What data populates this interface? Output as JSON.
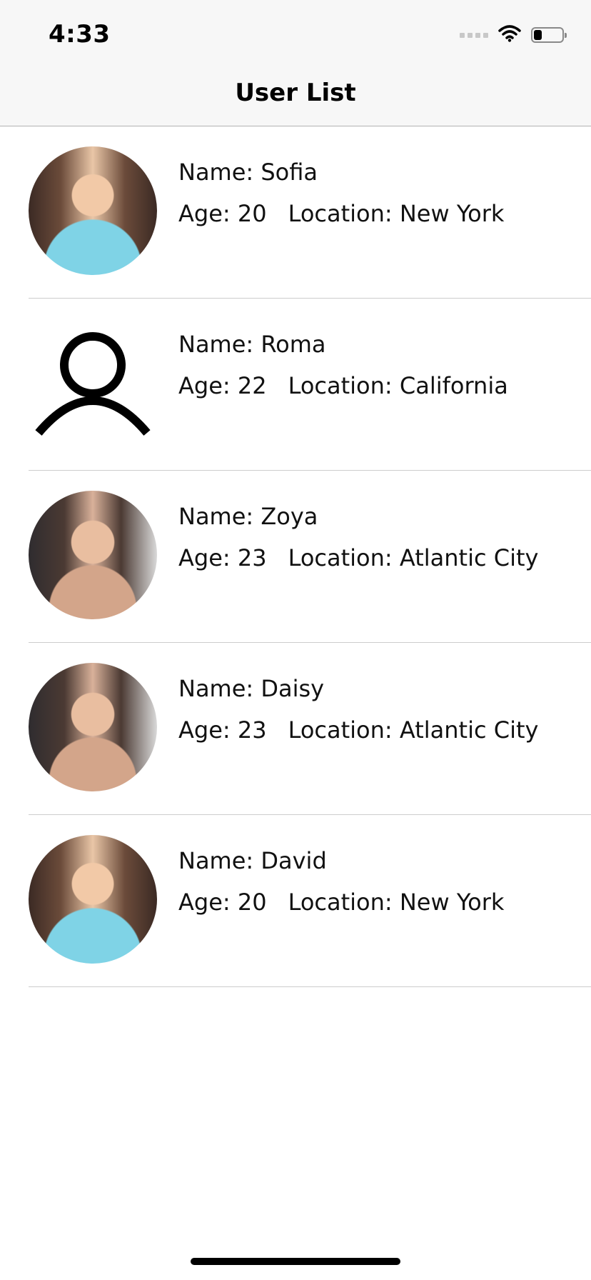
{
  "status_bar": {
    "time": "4:33",
    "icons": [
      "signal-dots-icon",
      "wifi-icon",
      "battery-icon"
    ],
    "battery_level": 0.3
  },
  "nav": {
    "title": "User List"
  },
  "users": [
    {
      "name_label": "Name: Sofia",
      "age_label": "Age: 20",
      "location_label": "Location: New York",
      "avatar": "photo"
    },
    {
      "name_label": "Name: Roma",
      "age_label": "Age: 22",
      "location_label": "Location: California",
      "avatar": "person-placeholder-icon"
    },
    {
      "name_label": "Name: Zoya",
      "age_label": "Age: 23",
      "location_label": "Location: Atlantic City",
      "avatar": "photo"
    },
    {
      "name_label": "Name: Daisy",
      "age_label": "Age: 23",
      "location_label": "Location: Atlantic City",
      "avatar": "photo"
    },
    {
      "name_label": "Name: David",
      "age_label": "Age: 20",
      "location_label": "Location: New York",
      "avatar": "photo"
    }
  ],
  "colors": {
    "nav_background": "#f7f7f7",
    "separator": "#cdcdcd",
    "text": "#111111"
  }
}
